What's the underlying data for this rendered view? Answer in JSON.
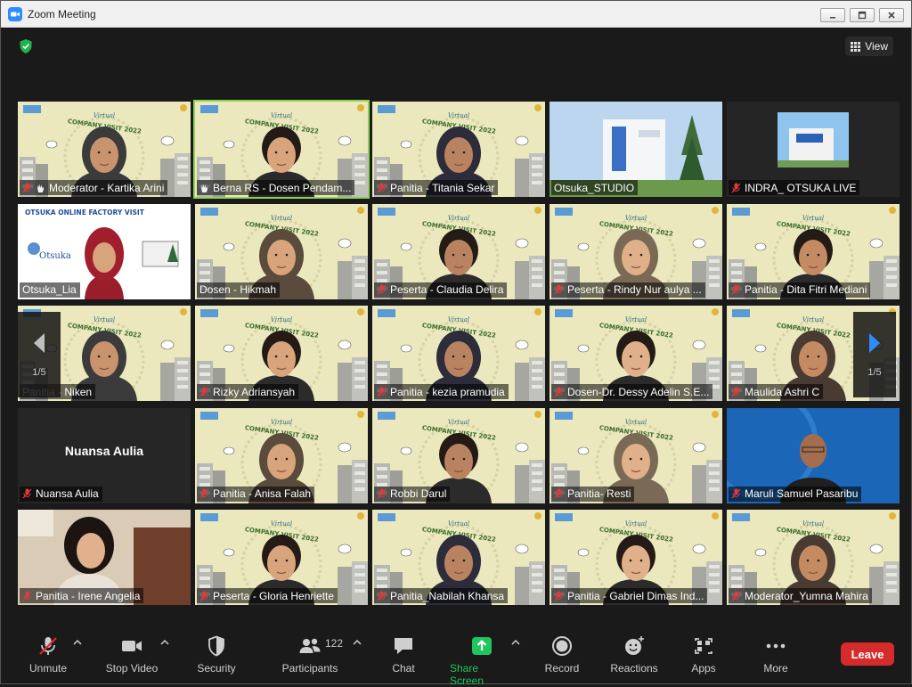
{
  "window": {
    "title": "Zoom Meeting"
  },
  "header": {
    "view_label": "View"
  },
  "grid": {
    "page_indicator_left": "1/5",
    "page_indicator_right": "1/5",
    "tiles": [
      {
        "name": "Moderator - Kartika Arini",
        "muted": true,
        "hand": true,
        "kind": "poster"
      },
      {
        "name": "Berna RS - Dosen Pendam...",
        "muted": false,
        "hand": true,
        "kind": "poster",
        "active": true
      },
      {
        "name": "Panitia - Titania Sekar",
        "muted": true,
        "kind": "poster"
      },
      {
        "name": "Otsuka_STUDIO",
        "muted": false,
        "kind": "building"
      },
      {
        "name": "INDRA_ OTSUKA LIVE",
        "muted": true,
        "kind": "dark-building"
      },
      {
        "name": "Otsuka_Lia",
        "muted": false,
        "kind": "factory",
        "banner": "OTSUKA ONLINE FACTORY VISIT",
        "logo": "Otsuka"
      },
      {
        "name": "Dosen - Hikmah",
        "muted": false,
        "kind": "poster"
      },
      {
        "name": "Peserta - Claudia Delira",
        "muted": true,
        "kind": "poster"
      },
      {
        "name": "Peserta - Rindy Nur aulya ...",
        "muted": true,
        "kind": "poster"
      },
      {
        "name": "Panitia - Dita Fitri Mediani",
        "muted": true,
        "kind": "poster"
      },
      {
        "name": "Panitia - Niken",
        "muted": false,
        "kind": "poster"
      },
      {
        "name": "Rizky Adriansyah",
        "muted": true,
        "kind": "poster"
      },
      {
        "name": "Panitia - kezia pramudia",
        "muted": true,
        "kind": "poster"
      },
      {
        "name": "Dosen-Dr. Dessy Adelin S.E...",
        "muted": true,
        "kind": "poster"
      },
      {
        "name": "Maulida Ashri C",
        "muted": true,
        "kind": "poster"
      },
      {
        "name": "Nuansa Aulia",
        "muted": true,
        "kind": "avatar",
        "display_name": "Nuansa Aulia"
      },
      {
        "name": "Panitia - Anisa Falah",
        "muted": true,
        "kind": "poster"
      },
      {
        "name": "Robbi Darul",
        "muted": true,
        "kind": "poster"
      },
      {
        "name": "Panitia- Resti",
        "muted": true,
        "kind": "poster"
      },
      {
        "name": "Maruli Samuel Pasaribu",
        "muted": true,
        "kind": "blue"
      },
      {
        "name": "Panitia - Irene Angelia",
        "muted": true,
        "kind": "room"
      },
      {
        "name": "Peserta - Gloria Henriette",
        "muted": true,
        "kind": "poster"
      },
      {
        "name": "Panitia_Nabilah Khansa",
        "muted": true,
        "kind": "poster"
      },
      {
        "name": "Panitia - Gabriel Dimas Ind...",
        "muted": true,
        "kind": "poster"
      },
      {
        "name": "Moderator_Yumna Mahira",
        "muted": true,
        "kind": "poster"
      }
    ]
  },
  "poster_text": {
    "title": "COMPANY VISIT 2022",
    "tag": "Virtual"
  },
  "toolbar": {
    "unmute": "Unmute",
    "stop_video": "Stop Video",
    "security": "Security",
    "participants": "Participants",
    "participants_count": "122",
    "chat": "Chat",
    "share_screen": "Share Screen",
    "record": "Record",
    "reactions": "Reactions",
    "apps": "Apps",
    "more": "More",
    "leave": "Leave"
  },
  "colors": {
    "accent": "#2D8CFF",
    "share_green": "#21C55D",
    "leave_red": "#D62B2B",
    "active_border": "#8BD44F",
    "poster_bg": "#E9E6B8"
  }
}
